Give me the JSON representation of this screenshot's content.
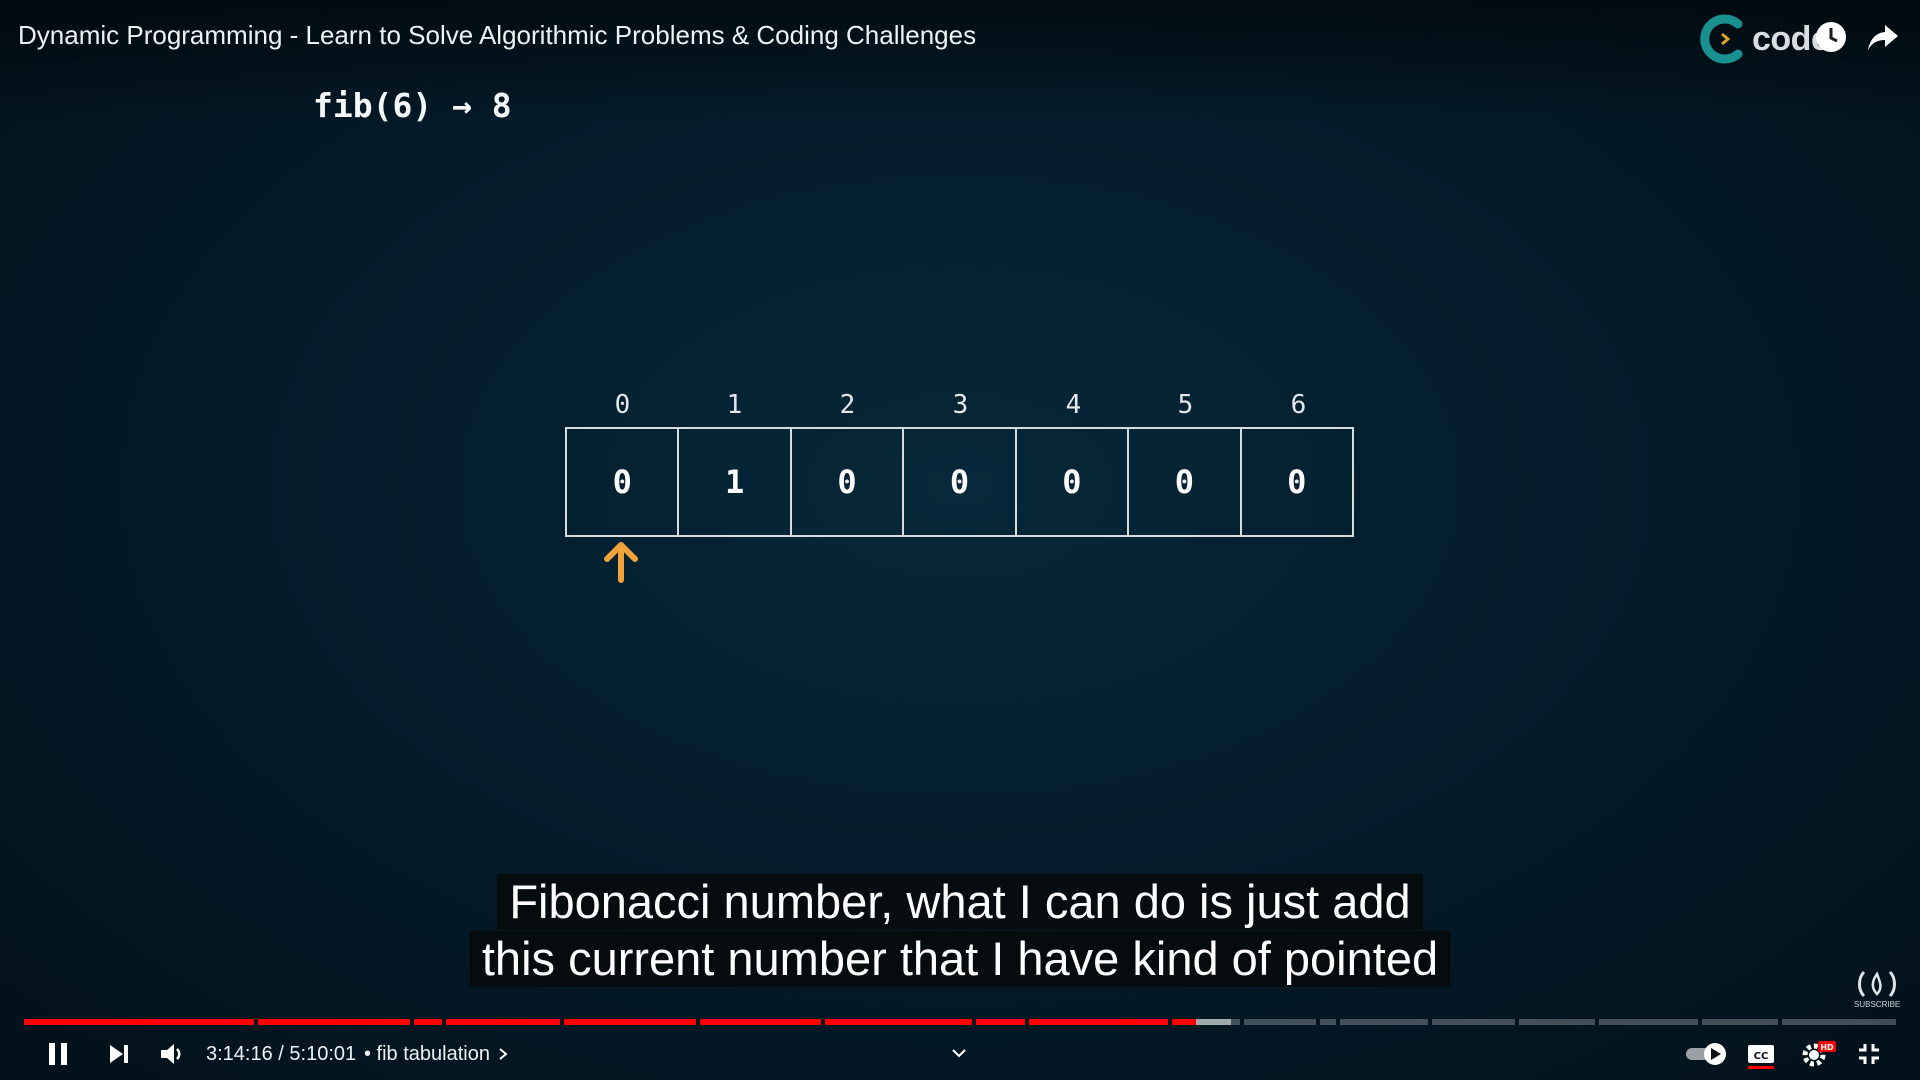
{
  "video": {
    "title": "Dynamic Programming - Learn to Solve Algorithmic Problems & Coding Challenges",
    "channel_logo_text": "code"
  },
  "slide": {
    "formula": "fib(6) → 8",
    "indices": [
      "0",
      "1",
      "2",
      "3",
      "4",
      "5",
      "6"
    ],
    "values": [
      "0",
      "1",
      "0",
      "0",
      "0",
      "0",
      "0"
    ],
    "pointer_index": 0,
    "pointer_color": "#f0a33a"
  },
  "captions": {
    "line1": "Fibonacci number, what I can do is just add",
    "line2": "this current number that I have kind of pointed"
  },
  "subscribe_badge": {
    "label": "SUBSCRIBE"
  },
  "player": {
    "current_time": "3:14:16",
    "duration": "5:10:01",
    "time_display": "3:14:16 / 5:10:01",
    "chapter_title": "• fib tabulation",
    "played_fraction": 0.626,
    "loaded_fraction": 0.645,
    "accent_color": "#ff0000"
  },
  "icons": {
    "pause": "pause-icon",
    "next": "next-icon",
    "volume": "volume-icon",
    "autoplay": "autoplay-toggle-icon",
    "captions": "cc-icon",
    "settings": "gear-icon",
    "fullscreen_exit": "exit-fullscreen-icon",
    "watch_later": "clock-icon",
    "share": "share-icon"
  }
}
